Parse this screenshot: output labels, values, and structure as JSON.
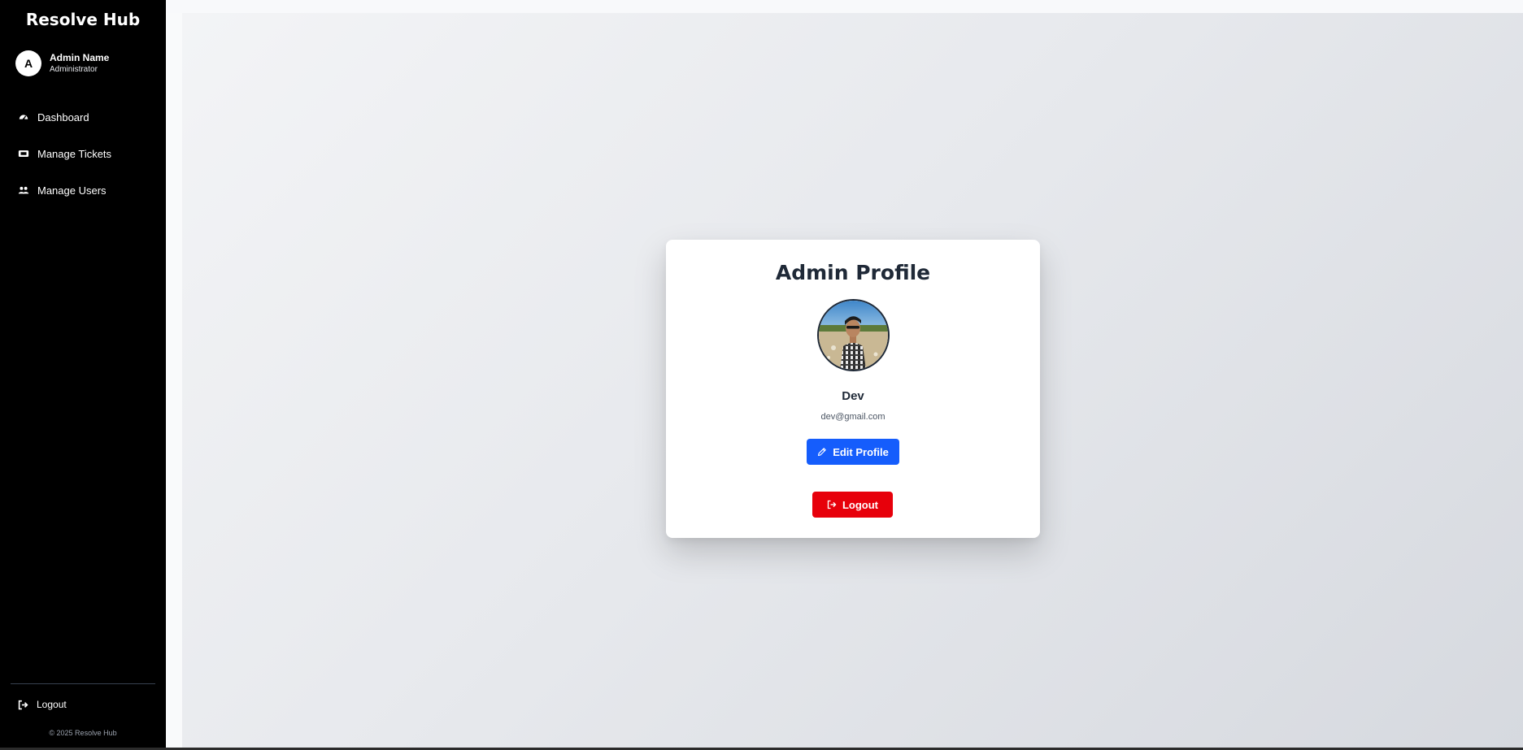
{
  "app": {
    "title": "Resolve Hub"
  },
  "user": {
    "initial": "A",
    "name": "Admin Name",
    "role": "Administrator"
  },
  "nav": {
    "items": [
      {
        "label": "Dashboard",
        "icon": "gauge-icon"
      },
      {
        "label": "Manage Tickets",
        "icon": "ticket-icon"
      },
      {
        "label": "Manage Users",
        "icon": "users-icon"
      }
    ]
  },
  "sidebar": {
    "logout_label": "Logout",
    "footer": "© 2025 Resolve Hub"
  },
  "profile": {
    "title": "Admin Profile",
    "name": "Dev",
    "email": "dev@gmail.com",
    "edit_label": "Edit Profile",
    "logout_label": "Logout",
    "photo_icon": "profile-photo"
  },
  "colors": {
    "sidebar_bg": "#000000",
    "primary": "#155dfc",
    "danger": "#e7000b",
    "text_dark": "#1f2937"
  }
}
